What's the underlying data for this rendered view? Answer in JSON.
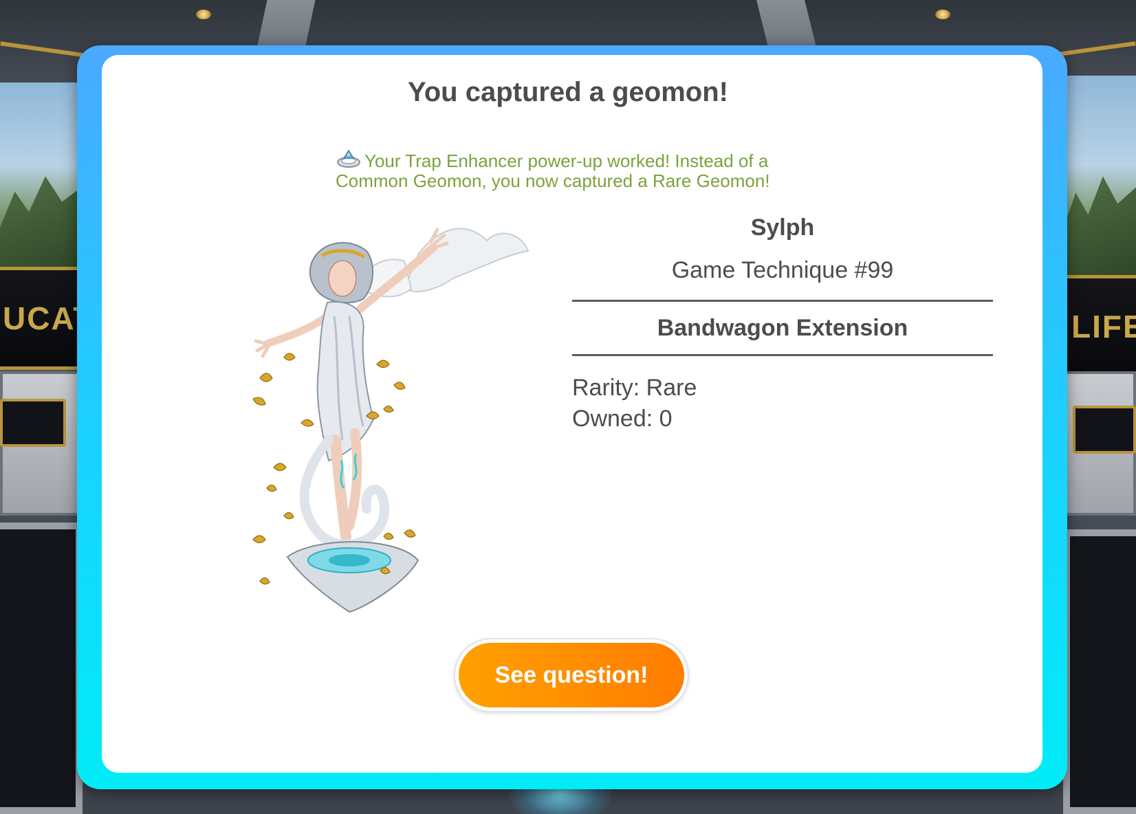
{
  "scene": {
    "banner_left_text": "UCATI",
    "banner_right_text": "LIFE"
  },
  "modal": {
    "title": "You captured a geomon!",
    "powerup_icon": "trap-enhancer-icon",
    "powerup_message": "Your Trap Enhancer power-up worked! Instead of a Common Geomon, you now captured a Rare Geomon!",
    "geomon": {
      "name": "Sylph",
      "number": "Game Technique #99",
      "topic": "Bandwagon Extension",
      "rarity": "Rarity: Rare",
      "owned": "Owned: 0"
    },
    "button_label": "See question!"
  },
  "colors": {
    "frame_top": "#4aa9ff",
    "frame_bottom": "#00ecf7",
    "button_orange": "#ff8a00",
    "powerup_green": "#7aa33a",
    "text_dark": "#4c4c4c"
  }
}
